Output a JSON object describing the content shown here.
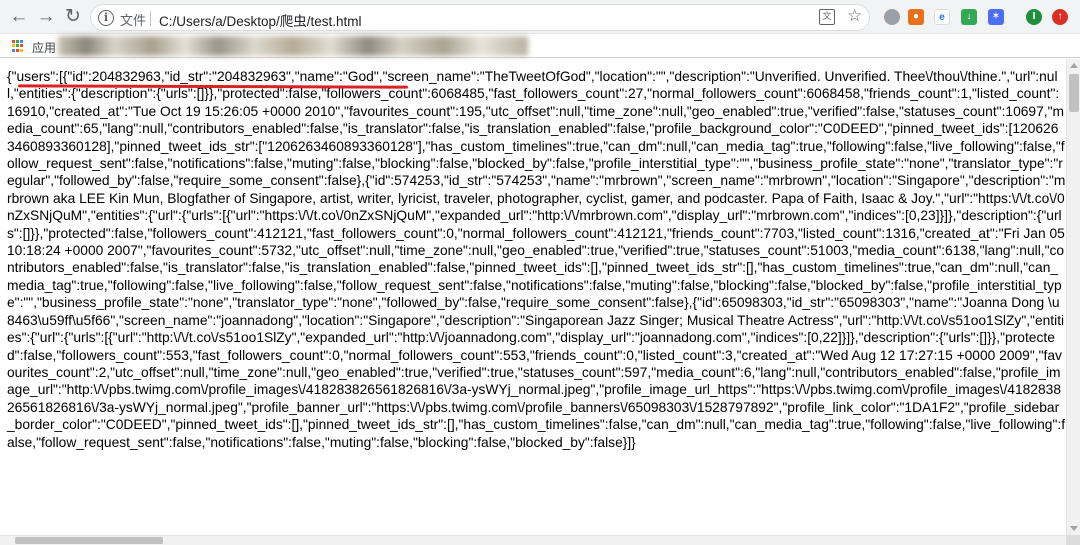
{
  "browser": {
    "file_label": "文件",
    "url": "C:/Users/a/Desktop/爬虫/test.html",
    "bookmarks_apps_label": "应用",
    "profile_initial": "I"
  },
  "page": {
    "json_text": "{\"users\":[{\"id\":204832963,\"id_str\":\"204832963\",\"name\":\"God\",\"screen_name\":\"TheTweetOfGod\",\"location\":\"\",\"description\":\"Unverified. Unverified. Thee\\/thou\\/thine.\",\"url\":null,\"entities\":{\"description\":{\"urls\":[]}},\"protected\":false,\"followers_count\":6068485,\"fast_followers_count\":27,\"normal_followers_count\":6068458,\"friends_count\":1,\"listed_count\":16910,\"created_at\":\"Tue Oct 19 15:26:05 +0000 2010\",\"favourites_count\":195,\"utc_offset\":null,\"time_zone\":null,\"geo_enabled\":true,\"verified\":false,\"statuses_count\":10697,\"media_count\":65,\"lang\":null,\"contributors_enabled\":false,\"is_translator\":false,\"is_translation_enabled\":false,\"profile_background_color\":\"C0DEED\",\"pinned_tweet_ids\":[1206263460893360128],\"pinned_tweet_ids_str\":[\"1206263460893360128\"],\"has_custom_timelines\":true,\"can_dm\":null,\"can_media_tag\":true,\"following\":false,\"live_following\":false,\"follow_request_sent\":false,\"notifications\":false,\"muting\":false,\"blocking\":false,\"blocked_by\":false,\"profile_interstitial_type\":\"\",\"business_profile_state\":\"none\",\"translator_type\":\"regular\",\"followed_by\":false,\"require_some_consent\":false},{\"id\":574253,\"id_str\":\"574253\",\"name\":\"mrbrown\",\"screen_name\":\"mrbrown\",\"location\":\"Singapore\",\"description\":\"mrbrown aka LEE Kin Mun, Blogfather of Singapore, artist, writer, lyricist, traveler, photographer, cyclist, gamer, and podcaster. Papa of Faith, Isaac & Joy.\",\"url\":\"https:\\/\\/t.co\\/0nZxSNjQuM\",\"entities\":{\"url\":{\"urls\":[{\"url\":\"https:\\/\\/t.co\\/0nZxSNjQuM\",\"expanded_url\":\"http:\\/\\/mrbrown.com\",\"display_url\":\"mrbrown.com\",\"indices\":[0,23]}]},\"description\":{\"urls\":[]}},\"protected\":false,\"followers_count\":412121,\"fast_followers_count\":0,\"normal_followers_count\":412121,\"friends_count\":7703,\"listed_count\":1316,\"created_at\":\"Fri Jan 05 10:18:24 +0000 2007\",\"favourites_count\":5732,\"utc_offset\":null,\"time_zone\":null,\"geo_enabled\":true,\"verified\":true,\"statuses_count\":51003,\"media_count\":6138,\"lang\":null,\"contributors_enabled\":false,\"is_translator\":false,\"is_translation_enabled\":false,\"pinned_tweet_ids\":[],\"pinned_tweet_ids_str\":[],\"has_custom_timelines\":true,\"can_dm\":null,\"can_media_tag\":true,\"following\":false,\"live_following\":false,\"follow_request_sent\":false,\"notifications\":false,\"muting\":false,\"blocking\":false,\"blocked_by\":false,\"profile_interstitial_type\":\"\",\"business_profile_state\":\"none\",\"translator_type\":\"none\",\"followed_by\":false,\"require_some_consent\":false},{\"id\":65098303,\"id_str\":\"65098303\",\"name\":\"Joanna Dong \\u8463\\u59ff\\u5f66\",\"screen_name\":\"joannadong\",\"location\":\"Singapore\",\"description\":\"Singaporean Jazz Singer; Musical Theatre Actress\",\"url\":\"http:\\/\\/t.co\\/s51oo1SlZy\",\"entities\":{\"url\":{\"urls\":[{\"url\":\"http:\\/\\/t.co\\/s51oo1SlZy\",\"expanded_url\":\"http:\\/\\/joannadong.com\",\"display_url\":\"joannadong.com\",\"indices\":[0,22]}]},\"description\":{\"urls\":[]}},\"protected\":false,\"followers_count\":553,\"fast_followers_count\":0,\"normal_followers_count\":553,\"friends_count\":0,\"listed_count\":3,\"created_at\":\"Wed Aug 12 17:27:15 +0000 2009\",\"favourites_count\":2,\"utc_offset\":null,\"time_zone\":null,\"geo_enabled\":true,\"verified\":true,\"statuses_count\":597,\"media_count\":6,\"lang\":null,\"contributors_enabled\":false,\"profile_image_url\":\"http:\\/\\/pbs.twimg.com\\/profile_images\\/418283826561826816\\/3a-ysWYj_normal.jpeg\",\"profile_image_url_https\":\"https:\\/\\/pbs.twimg.com\\/profile_images\\/418283826561826816\\/3a-ysWYj_normal.jpeg\",\"profile_banner_url\":\"https:\\/\\/pbs.twimg.com\\/profile_banners\\/65098303\\/1528797892\",\"profile_link_color\":\"1DA1F2\",\"profile_sidebar_border_color\":\"C0DEED\",\"pinned_tweet_ids\":[],\"pinned_tweet_ids_str\":[],\"has_custom_timelines\":false,\"can_dm\":null,\"can_media_tag\":true,\"following\":false,\"live_following\":false,\"follow_request_sent\":false,\"notifications\":false,\"muting\":false,\"blocking\":false,\"blocked_by\":false}]}"
  },
  "icons": {
    "back": "back-arrow-icon",
    "forward": "forward-arrow-icon",
    "reload": "reload-icon",
    "info": "info-icon",
    "translate": "translate-icon",
    "star": "bookmark-star-icon",
    "apps": "apps-grid-icon"
  },
  "colors": {
    "annotation_underline": "#d92323",
    "toolbar_bg": "#f1f3f4",
    "profile_avatar": "#1e8e3e",
    "update_button": "#d93025"
  }
}
